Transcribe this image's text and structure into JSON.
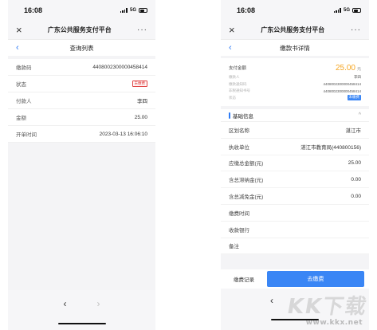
{
  "left": {
    "status": {
      "time": "16:08",
      "network": "5G"
    },
    "appbar": {
      "title": "广东公共服务支付平台",
      "close_icon": "×",
      "more_icon": "···"
    },
    "navbar": {
      "back_icon": "‹",
      "title": "查询列表"
    },
    "rows": [
      {
        "label": "缴款码",
        "value": "4408002300000458414"
      },
      {
        "label": "状态",
        "badge": "未缴费"
      },
      {
        "label": "付款人",
        "value": "李四"
      },
      {
        "label": "金额",
        "value": "25.00"
      },
      {
        "label": "开单时间",
        "value": "2023-03-13 16:06:10"
      }
    ],
    "bottom": {
      "back_arrow": "‹",
      "forward_arrow": "›"
    }
  },
  "right": {
    "status": {
      "time": "16:08",
      "network": "5G"
    },
    "appbar": {
      "title": "广东公共服务支付平台",
      "close_icon": "×",
      "more_icon": "···"
    },
    "navbar": {
      "back_icon": "‹",
      "title": "缴款书详情"
    },
    "amount": {
      "label": "支付金额",
      "value": "25.00",
      "unit": "元"
    },
    "mini_rows": [
      {
        "label": "缴款人",
        "value": "李四"
      },
      {
        "label": "缴款通知码",
        "value": "4408002300000458414"
      },
      {
        "label": "非税通知书号",
        "value": "4408002300000458414"
      },
      {
        "label": "状态",
        "badge": "未缴费"
      }
    ],
    "section": {
      "title": "基础信息",
      "chevron": "^"
    },
    "details": [
      {
        "label": "区划名称",
        "value": "湛江市"
      },
      {
        "label": "执收单位",
        "value": "湛江市教育局(440800156)"
      },
      {
        "label": "应缴总金额(元)",
        "value": "25.00"
      },
      {
        "label": "含总滞纳金(元)",
        "value": "0.00"
      },
      {
        "label": "含总减免金(元)",
        "value": "0.00"
      },
      {
        "label": "缴费时间",
        "value": ""
      },
      {
        "label": "收款银行",
        "value": ""
      },
      {
        "label": "备注",
        "value": ""
      }
    ],
    "actions": {
      "record_label": "缴费记录",
      "pay_label": "去缴费"
    },
    "bottom": {
      "back_arrow": "‹"
    }
  },
  "watermark": {
    "text": "KK下载",
    "url": "www.kkx.net"
  },
  "colors": {
    "accent": "#3a86f5",
    "amount": "#f5a623",
    "badge_red": "#e04646"
  }
}
